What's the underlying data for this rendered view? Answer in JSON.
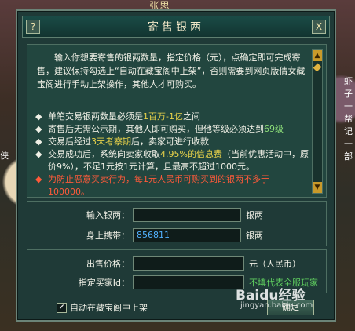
{
  "background": {
    "npc_name": "张思",
    "right_side_text": "虾子 一帮 记 一部",
    "left_side_text": "侠"
  },
  "dialog": {
    "title": "寄售银两",
    "help_button": "?",
    "close_button": "X",
    "intro": "输入你想要寄售的银两数量，指定价格（元），点确定即可完成寄售，建议保持勾选上“自动在藏宝阁中上架”，否则需要到网页版倩女藏宝阁进行手动上架操作，其他人才可购买。",
    "rules": [
      {
        "pre": "单笔交易银两数量必须是",
        "hl": "1百万-1亿",
        "post": "之间"
      },
      {
        "pre": "寄售后无需公示期，其他人即可购买，但他等级必须达到",
        "hl": "69级",
        "post": ""
      },
      {
        "pre": "交易后经过",
        "hl": "3天考察期",
        "post": "后，卖家可进行收款"
      },
      {
        "pre": "交易成功后，系统向卖家收取",
        "hl": "4.95%的信息费",
        "post": "（当前优惠活动中，原价9%），不足1元按1元计算，且最高不超过1000元。"
      }
    ],
    "warning": "为防止恶意买卖行为，每1元人民币可购买到的银两不多于100000。",
    "form": {
      "input_silver_label": "输入银两：",
      "input_silver_value": "",
      "silver_unit": "银两",
      "carried_label": "身上携带：",
      "carried_value": "856811",
      "carried_unit": "银两",
      "price_label": "出售价格：",
      "price_value": "",
      "price_unit": "元（人民币）",
      "buyer_label": "指定买家Id：",
      "buyer_value": "",
      "buyer_hint": "不填代表全服玩家"
    },
    "auto_list_label": "自动在藏宝阁中上架",
    "auto_list_checked": true,
    "ok_button": "确定"
  },
  "watermark": {
    "text": "Baidu经验",
    "url": "jingyan.baidu.com"
  }
}
